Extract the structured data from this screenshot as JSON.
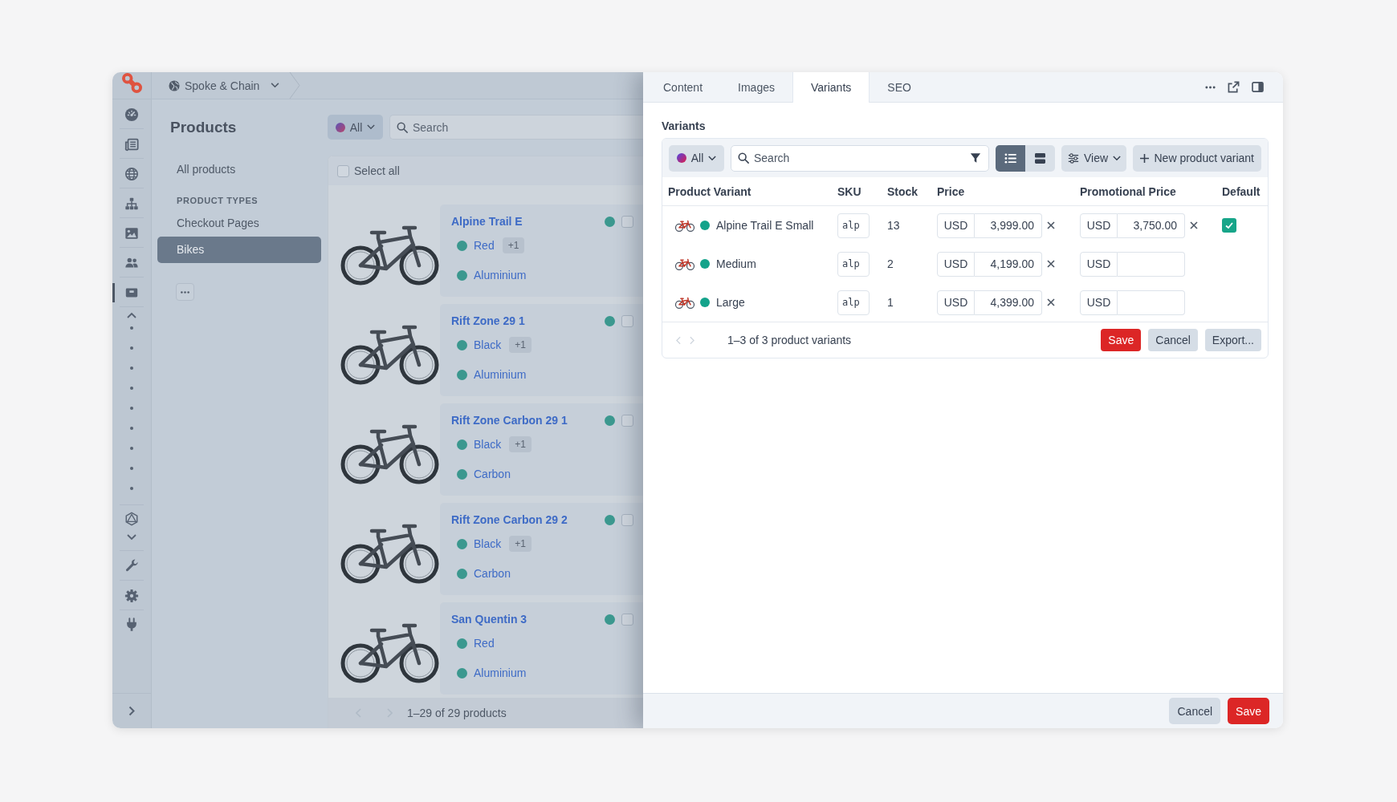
{
  "rail": {
    "items": [
      {
        "selected": false
      },
      {
        "selected": false
      },
      {
        "selected": false
      },
      {
        "selected": false
      },
      {
        "selected": false
      },
      {
        "selected": false
      },
      {
        "selected": true
      }
    ]
  },
  "breadcrumb": {
    "workspace": "Spoke & Chain"
  },
  "catalog_nav": {
    "title": "Products",
    "items": [
      {
        "label": "All products",
        "selected": false
      }
    ],
    "section": "PRODUCT TYPES",
    "types": [
      {
        "label": "Checkout Pages",
        "selected": false
      },
      {
        "label": "Bikes",
        "selected": true
      }
    ]
  },
  "product_list": {
    "filter": {
      "label": "All"
    },
    "search": {
      "placeholder": "Search"
    },
    "select_all": {
      "label": "Select all",
      "checked": false
    },
    "products": [
      {
        "name": "Alpine Trail E",
        "checked": false,
        "tags": [
          {
            "label": "Red",
            "extra": "+1"
          },
          {
            "label": "Aluminium"
          }
        ]
      },
      {
        "name": "Rift Zone 29 1",
        "checked": false,
        "tags": [
          {
            "label": "Black",
            "extra": "+1"
          },
          {
            "label": "Aluminium"
          }
        ]
      },
      {
        "name": "Rift Zone Carbon 29 1",
        "checked": false,
        "tags": [
          {
            "label": "Black",
            "extra": "+1"
          },
          {
            "label": "Carbon"
          }
        ]
      },
      {
        "name": "Rift Zone Carbon 29 2",
        "checked": false,
        "tags": [
          {
            "label": "Black",
            "extra": "+1"
          },
          {
            "label": "Carbon"
          }
        ]
      },
      {
        "name": "San Quentin 3",
        "checked": false,
        "tags": [
          {
            "label": "Red"
          },
          {
            "label": "Aluminium"
          }
        ]
      }
    ],
    "pagination": "1–29 of 29 products"
  },
  "panel": {
    "tabs": [
      {
        "label": "Content",
        "selected": false
      },
      {
        "label": "Images",
        "selected": false
      },
      {
        "label": "Variants",
        "selected": true
      },
      {
        "label": "SEO",
        "selected": false
      }
    ],
    "section_title": "Variants",
    "toolbar": {
      "filter": {
        "label": "All"
      },
      "search": {
        "placeholder": "Search"
      },
      "layouts": [
        {
          "selected": true
        },
        {
          "selected": false
        }
      ],
      "view": {
        "label": "View"
      },
      "new_button": {
        "label": "New product variant"
      }
    },
    "table": {
      "columns": [
        "Product Variant",
        "SKU",
        "Stock",
        "Price",
        "Promotional Price",
        "Default"
      ],
      "rows": [
        {
          "name": "Alpine Trail E Small",
          "sku": "alp",
          "stock": "13",
          "price": {
            "currency": "USD",
            "value": "3,999.00"
          },
          "promo_price": {
            "currency": "USD",
            "value": "3,750.00"
          },
          "default": true
        },
        {
          "name": "Medium",
          "sku": "alp",
          "stock": "2",
          "price": {
            "currency": "USD",
            "value": "4,199.00"
          },
          "promo_price": {
            "currency": "USD"
          },
          "default": false
        },
        {
          "name": "Large",
          "sku": "alp",
          "stock": "1",
          "price": {
            "currency": "USD",
            "value": "4,399.00"
          },
          "promo_price": {
            "currency": "USD"
          },
          "default": false
        }
      ]
    },
    "table_footer": {
      "summary": "1–3 of 3 product variants",
      "buttons": [
        {
          "label": "Save",
          "kind": "primary"
        },
        {
          "label": "Cancel",
          "kind": "secondary"
        },
        {
          "label": "Export...",
          "kind": "secondary"
        }
      ]
    },
    "actions": [
      {
        "label": "Cancel",
        "kind": "secondary"
      },
      {
        "label": "Save",
        "kind": "primary"
      }
    ]
  }
}
